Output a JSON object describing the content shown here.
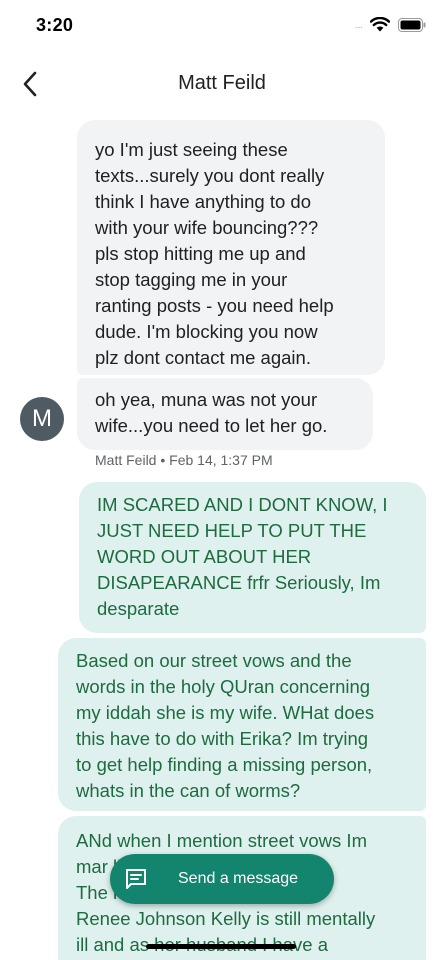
{
  "status_bar": {
    "time": "3:20",
    "signal": "....",
    "wifi_icon": "wifi-icon",
    "battery_icon": "battery-icon"
  },
  "header": {
    "back_icon": "chevron-left-icon",
    "title": "Matt Feild"
  },
  "messages": [
    {
      "direction": "incoming",
      "text": "yo I'm just seeing these\ntexts...surely you dont really\nthink I have anything to do\nwith your wife bouncing???\npls stop hitting me up and\nstop tagging me in your\nranting posts - you need help\ndude. I'm blocking you now\nplz dont contact me again."
    },
    {
      "direction": "incoming",
      "text": "oh yea, muna was not your\nwife...you need to let her go."
    },
    {
      "direction": "outgoing",
      "text": "IM SCARED AND I DONT KNOW, I\nJUST NEED HELP TO PUT THE\nWORD OUT ABOUT HER\nDISAPEARANCE frfr Seriously, Im\ndesparate"
    },
    {
      "direction": "outgoing",
      "text": "Based on our street vows and the\nwords in the holy QUran concerning\nmy iddah she is my wife. WHat does\nthis have to do with Erika? Im trying\nto get help finding a missing person,\nwhats in the can of worms?"
    },
    {
      "direction": "outgoing",
      "text": "ANd when I mention street vows Im\nmar                                         lly!...\nThe                                          rika\nRenee Johnson Kelly is still mentally\nill and as her husband I have a"
    }
  ],
  "avatar_initial": "M",
  "message_meta": "Matt Feild • Feb 14, 1:37 PM",
  "fab": {
    "icon": "message-icon",
    "label": "Send a message"
  },
  "colors": {
    "incoming_bubble": "#f1f3f4",
    "outgoing_bubble": "#dff1ee",
    "outgoing_text": "#1e6b40",
    "fab_background": "#13856f",
    "avatar_background": "#4f5b62"
  }
}
